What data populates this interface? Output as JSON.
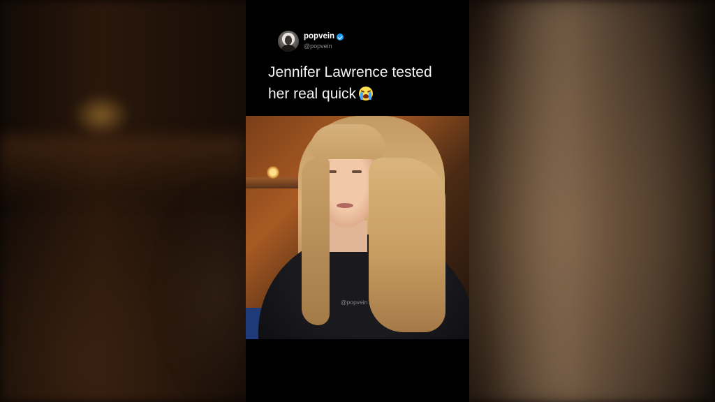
{
  "post": {
    "display_name": "popvein",
    "handle": "@popvein",
    "verified": true,
    "caption_line1": "Jennifer Lawrence tested",
    "caption_line2": "her real quick",
    "caption_emoji": "loudly-crying-face"
  },
  "video": {
    "watermark": "@popvein"
  },
  "colors": {
    "panel_background": "#000000",
    "verified_badge": "#1d9bf0",
    "handle_text": "#8b8b8b",
    "caption_text": "#f4f4f4"
  }
}
